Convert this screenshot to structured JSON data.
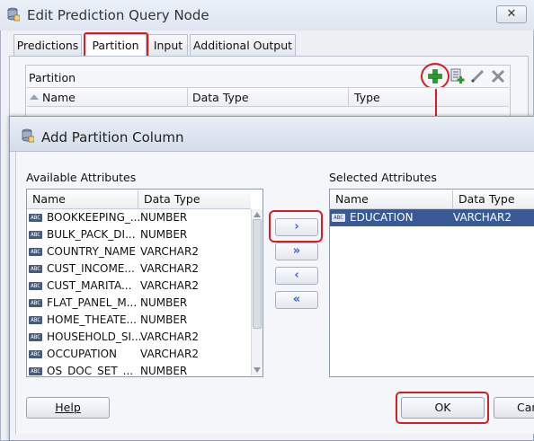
{
  "outer_window": {
    "title": "Edit Prediction Query Node",
    "close_glyph": "✕",
    "tabs": [
      {
        "label": "Predictions",
        "active": false
      },
      {
        "label": "Partition",
        "active": true
      },
      {
        "label": "Input",
        "active": false
      },
      {
        "label": "Additional Output",
        "active": false
      }
    ],
    "partition_panel": {
      "label": "Partition",
      "columns": [
        "Name",
        "Data Type",
        "Type"
      ],
      "toolbar_icons": [
        "add-icon",
        "add-column-icon",
        "edit-icon",
        "delete-icon"
      ]
    }
  },
  "dialog": {
    "title": "Add Partition Column",
    "available": {
      "label": "Available Attributes",
      "columns": [
        "Name",
        "Data Type"
      ],
      "rows": [
        {
          "name": "BOOKKEEPING_...",
          "type": "NUMBER"
        },
        {
          "name": "BULK_PACK_DI...",
          "type": "NUMBER"
        },
        {
          "name": "COUNTRY_NAME",
          "type": "VARCHAR2"
        },
        {
          "name": "CUST_INCOME...",
          "type": "VARCHAR2"
        },
        {
          "name": "CUST_MARITA...",
          "type": "VARCHAR2"
        },
        {
          "name": "FLAT_PANEL_M...",
          "type": "NUMBER"
        },
        {
          "name": "HOME_THEATE...",
          "type": "NUMBER"
        },
        {
          "name": "HOUSEHOLD_SI...",
          "type": "VARCHAR2"
        },
        {
          "name": "OCCUPATION",
          "type": "VARCHAR2"
        },
        {
          "name": "OS_DOC_SET_...",
          "type": "NUMBER"
        }
      ]
    },
    "selected": {
      "label": "Selected Attributes",
      "columns": [
        "Name",
        "Data Type"
      ],
      "rows": [
        {
          "name": "EDUCATION",
          "type": "VARCHAR2"
        }
      ]
    },
    "move_buttons": {
      "move_right": "›",
      "move_all_right": "»",
      "move_left": "‹",
      "move_all_left": "«"
    },
    "buttons": {
      "help": "Help",
      "ok": "OK",
      "cancel": "Car"
    }
  },
  "colors": {
    "highlight_red": "#d32027",
    "selection_blue": "#3a5a97",
    "add_green": "#2e9a2e"
  }
}
